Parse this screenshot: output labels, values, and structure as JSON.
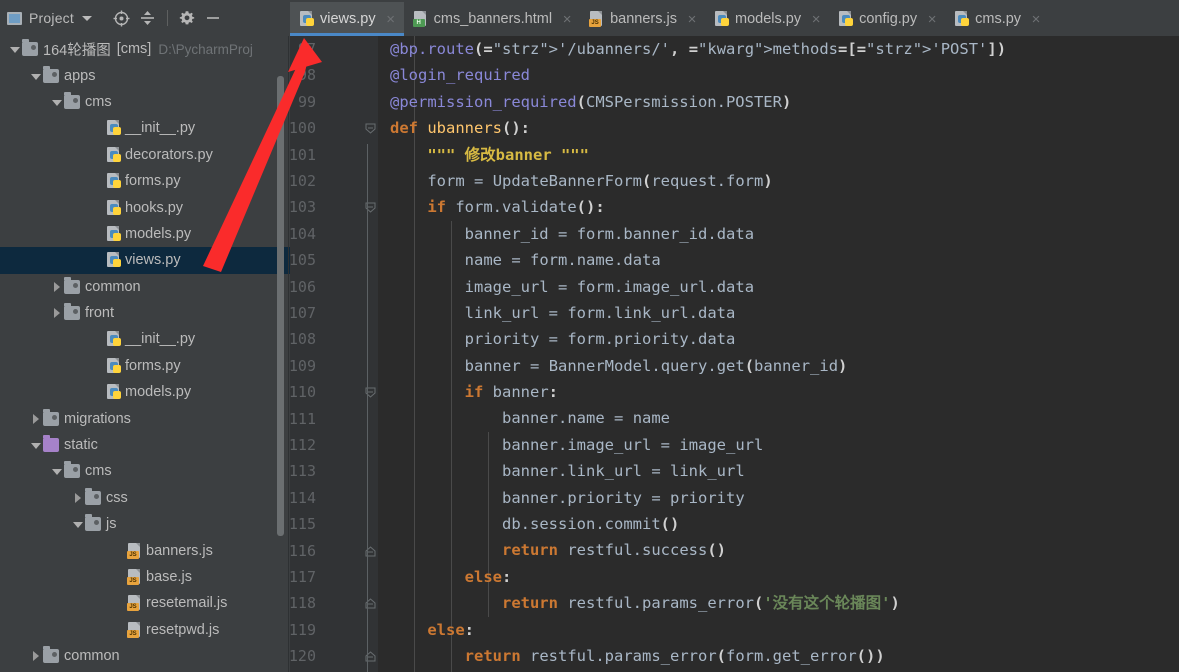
{
  "toolbar": {
    "project_label": "Project",
    "caret_icon": "chevron-down-icon",
    "buttons": [
      {
        "name": "locate-icon",
        "glyph": "target"
      },
      {
        "name": "collapse-all-icon",
        "glyph": "collapse"
      },
      {
        "name": "settings-gear-icon",
        "glyph": "gear"
      },
      {
        "name": "hide-panel-icon",
        "glyph": "minus"
      }
    ]
  },
  "tabs": [
    {
      "label": "views.py",
      "icon": "python-file-icon",
      "type": "py",
      "active": true
    },
    {
      "label": "cms_banners.html",
      "icon": "html-file-icon",
      "type": "html",
      "active": false
    },
    {
      "label": "banners.js",
      "icon": "javascript-file-icon",
      "type": "js",
      "active": false
    },
    {
      "label": "models.py",
      "icon": "python-file-icon",
      "type": "py",
      "active": false
    },
    {
      "label": "config.py",
      "icon": "python-file-icon",
      "type": "py",
      "active": false
    },
    {
      "label": "cms.py",
      "icon": "python-file-icon",
      "type": "py",
      "active": false
    }
  ],
  "tab_close_glyph": "×",
  "project_tree": [
    {
      "label": "164轮播图",
      "bold": "[cms]",
      "path": "D:\\PycharmProj",
      "kind": "folder",
      "depth": 0,
      "arrow": "down",
      "selected": false
    },
    {
      "label": "apps",
      "kind": "folder",
      "depth": 1,
      "arrow": "down",
      "selected": false
    },
    {
      "label": "cms",
      "kind": "folder",
      "depth": 2,
      "arrow": "down",
      "selected": false
    },
    {
      "label": "__init__.py",
      "kind": "py",
      "depth": 4,
      "arrow": "none",
      "selected": false
    },
    {
      "label": "decorators.py",
      "kind": "py",
      "depth": 4,
      "arrow": "none",
      "selected": false
    },
    {
      "label": "forms.py",
      "kind": "py",
      "depth": 4,
      "arrow": "none",
      "selected": false
    },
    {
      "label": "hooks.py",
      "kind": "py",
      "depth": 4,
      "arrow": "none",
      "selected": false
    },
    {
      "label": "models.py",
      "kind": "py",
      "depth": 4,
      "arrow": "none",
      "selected": false
    },
    {
      "label": "views.py",
      "kind": "py",
      "depth": 4,
      "arrow": "none",
      "selected": true
    },
    {
      "label": "common",
      "kind": "folder",
      "depth": 2,
      "arrow": "right",
      "selected": false
    },
    {
      "label": "front",
      "kind": "folder",
      "depth": 2,
      "arrow": "right",
      "selected": false
    },
    {
      "label": "__init__.py",
      "kind": "py",
      "depth": 4,
      "arrow": "none",
      "selected": false
    },
    {
      "label": "forms.py",
      "kind": "py",
      "depth": 4,
      "arrow": "none",
      "selected": false
    },
    {
      "label": "models.py",
      "kind": "py",
      "depth": 4,
      "arrow": "none",
      "selected": false
    },
    {
      "label": "migrations",
      "kind": "folder",
      "depth": 1,
      "arrow": "right",
      "selected": false
    },
    {
      "label": "static",
      "kind": "folder-purple",
      "depth": 1,
      "arrow": "down",
      "selected": false
    },
    {
      "label": "cms",
      "kind": "folder",
      "depth": 2,
      "arrow": "down",
      "selected": false
    },
    {
      "label": "css",
      "kind": "folder",
      "depth": 3,
      "arrow": "right",
      "selected": false
    },
    {
      "label": "js",
      "kind": "folder",
      "depth": 3,
      "arrow": "down",
      "selected": false
    },
    {
      "label": "banners.js",
      "kind": "js",
      "depth": 5,
      "arrow": "none",
      "selected": false
    },
    {
      "label": "base.js",
      "kind": "js",
      "depth": 5,
      "arrow": "none",
      "selected": false
    },
    {
      "label": "resetemail.js",
      "kind": "js",
      "depth": 5,
      "arrow": "none",
      "selected": false
    },
    {
      "label": "resetpwd.js",
      "kind": "js",
      "depth": 5,
      "arrow": "none",
      "selected": false
    },
    {
      "label": "common",
      "kind": "folder",
      "depth": 1,
      "arrow": "right",
      "selected": false
    }
  ],
  "editor": {
    "filename": "views.py",
    "first_line_number": 97,
    "line_numbers": [
      97,
      98,
      99,
      100,
      101,
      102,
      103,
      104,
      105,
      106,
      107,
      108,
      109,
      110,
      111,
      112,
      113,
      114,
      115,
      116,
      117,
      118,
      119,
      120
    ],
    "code_lines": [
      "@bp.route('/ubanners/', methods=['POST'])",
      "@login_required",
      "@permission_required(CMSPersmission.POSTER)",
      "def ubanners():",
      "    \"\"\" 修改banner \"\"\"",
      "    form = UpdateBannerForm(request.form)",
      "    if form.validate():",
      "        banner_id = form.banner_id.data",
      "        name = form.name.data",
      "        image_url = form.image_url.data",
      "        link_url = form.link_url.data",
      "        priority = form.priority.data",
      "        banner = BannerModel.query.get(banner_id)",
      "        if banner:",
      "            banner.name = name",
      "            banner.image_url = image_url",
      "            banner.link_url = link_url",
      "            banner.priority = priority",
      "            db.session.commit()",
      "            return restful.success()",
      "        else:",
      "            return restful.params_error('没有这个轮播图')",
      "    else:",
      "        return restful.params_error(form.get_error())"
    ],
    "fold_markers_open": [
      100,
      103,
      110
    ],
    "fold_markers_close": [
      116,
      118,
      120
    ]
  },
  "annotation": {
    "name": "red-arrow-pointing-to-views-tab",
    "color": "#fa2b2b"
  },
  "colors": {
    "editor_bg": "#2b2b2b",
    "gutter_bg": "#313335",
    "panel_bg": "#3c3f41",
    "tab_active_bg": "#4e5254",
    "tab_underline": "#4a88c7",
    "selection_bg": "#0d293e",
    "keyword": "#cc7832",
    "string": "#6a8759",
    "decorator": "#8a88d8",
    "docstring": "#d7ba43",
    "default_text": "#a9b7c6",
    "line_number": "#606366"
  }
}
